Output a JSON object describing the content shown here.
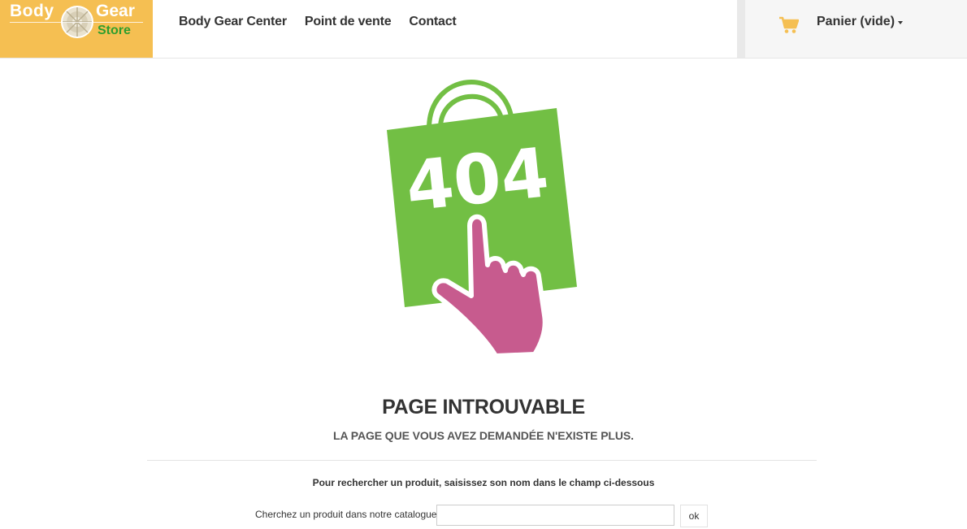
{
  "logo": {
    "word1": "Body",
    "word2": "Gear",
    "word3": "Store",
    "bg_color": "#f5bf52",
    "store_color": "#2e9e2e"
  },
  "nav": {
    "items": [
      "Body Gear Center",
      "Point de vente",
      "Contact"
    ]
  },
  "cart": {
    "label": "Panier (vide)",
    "icon": "shopping-cart-icon",
    "icon_color": "#f5bf52"
  },
  "illustration": {
    "code": "404",
    "bag_color": "#72bf44",
    "hand_color": "#c75b8e",
    "icon": "404-shopping-bag-icon"
  },
  "error": {
    "title": "PAGE INTROUVABLE",
    "subtitle": "LA PAGE QUE VOUS AVEZ DEMANDÉE N'EXISTE PLUS."
  },
  "search": {
    "hint": "Pour rechercher un produit, saisissez son nom dans le champ ci-dessous",
    "label": "Cherchez un produit dans notre catalogue :",
    "value": "",
    "button": "ok"
  }
}
